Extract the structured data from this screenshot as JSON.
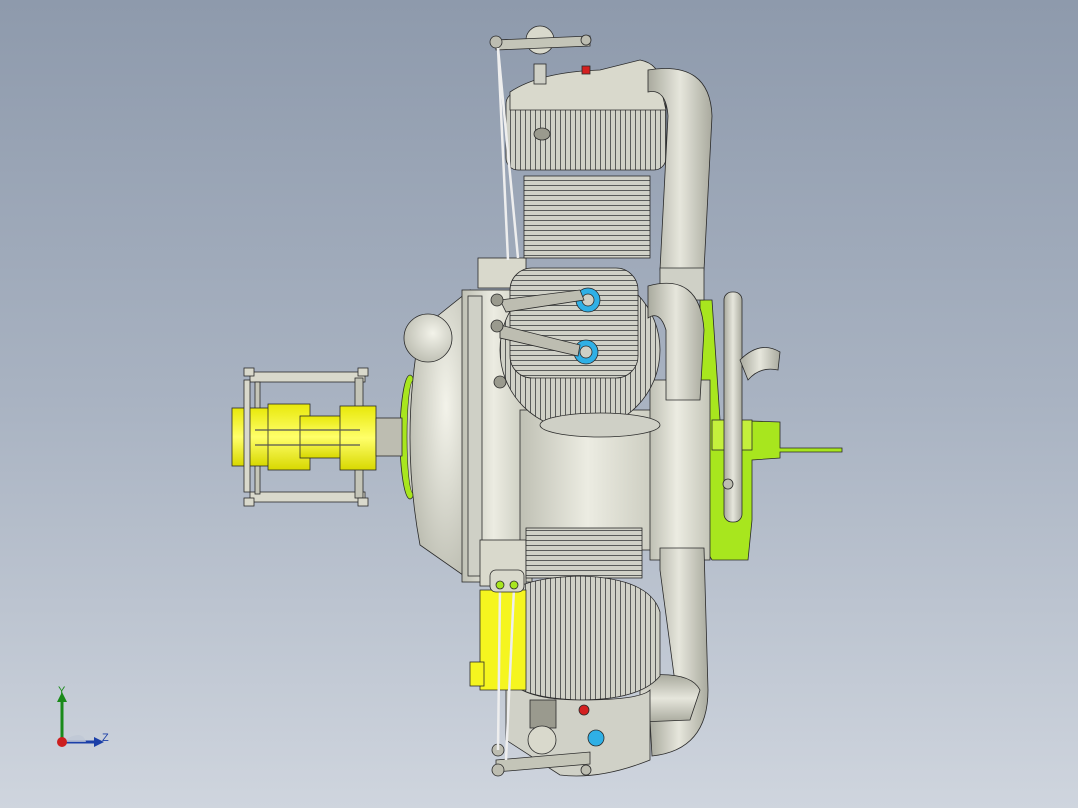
{
  "viewport": {
    "background_top": "#8e9aac",
    "background_bottom": "#cfd5de"
  },
  "model": {
    "colors": {
      "body": "#d9d9cc",
      "body_shadow": "#b9b9ab",
      "fins": "#8f9291",
      "pipe": "#cfd0c6",
      "yellow_part": "#f5f51f",
      "green_part": "#a8e61e",
      "cyan_port": "#2fb0e6",
      "red_cap": "#d42020",
      "outline": "#2a2a2a"
    }
  },
  "triad": {
    "y_label": "Y",
    "z_label": "Z",
    "y_color": "#1a8a1a",
    "z_color": "#1b3fa8",
    "x_color": "#cc1f1f"
  }
}
